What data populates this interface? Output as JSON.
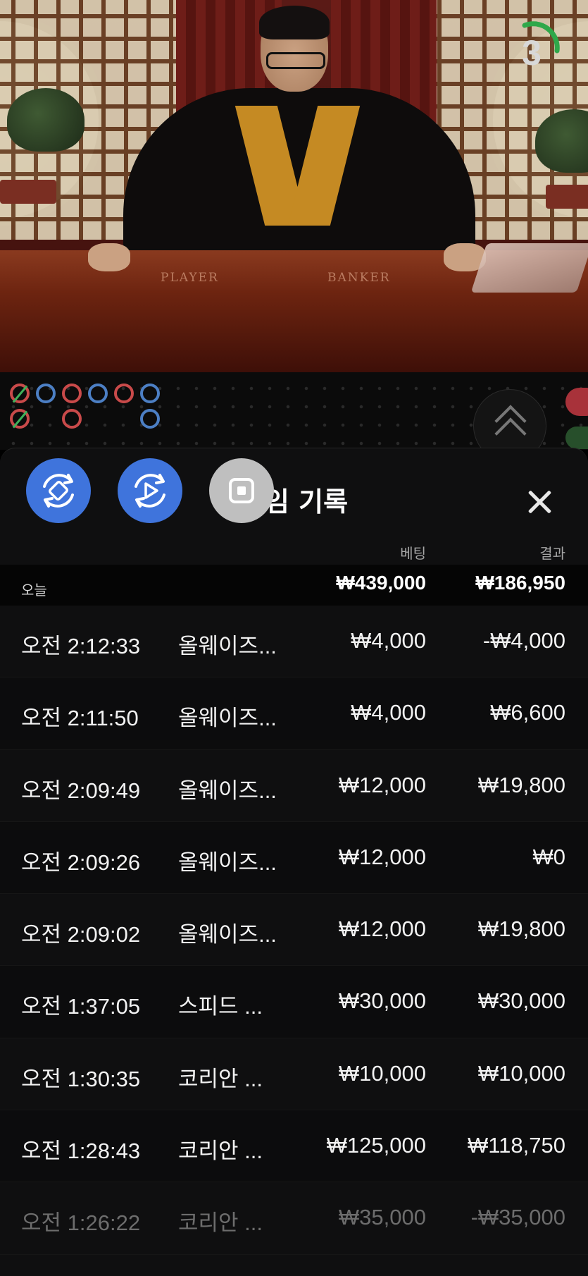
{
  "video": {
    "countdown": "3",
    "table_labels": {
      "player": "PLAYER",
      "banker": "BANKER"
    }
  },
  "history": {
    "title": "게임 기록",
    "columns": {
      "bet": "베팅",
      "result": "결과"
    },
    "today": {
      "label": "오늘",
      "bet": "₩439,000",
      "result": "₩186,950"
    },
    "rows": [
      {
        "time": "오전 2:12:33",
        "game": "올웨이즈...",
        "bet": "₩4,000",
        "result": "-₩4,000"
      },
      {
        "time": "오전 2:11:50",
        "game": "올웨이즈...",
        "bet": "₩4,000",
        "result": "₩6,600"
      },
      {
        "time": "오전 2:09:49",
        "game": "올웨이즈...",
        "bet": "₩12,000",
        "result": "₩19,800"
      },
      {
        "time": "오전 2:09:26",
        "game": "올웨이즈...",
        "bet": "₩12,000",
        "result": "₩0"
      },
      {
        "time": "오전 2:09:02",
        "game": "올웨이즈...",
        "bet": "₩12,000",
        "result": "₩19,800"
      },
      {
        "time": "오전 1:37:05",
        "game": "스피드 ...",
        "bet": "₩30,000",
        "result": "₩30,000"
      },
      {
        "time": "오전 1:30:35",
        "game": "코리안 ...",
        "bet": "₩10,000",
        "result": "₩10,000"
      },
      {
        "time": "오전 1:28:43",
        "game": "코리안 ...",
        "bet": "₩125,000",
        "result": "₩118,750"
      },
      {
        "time": "오전 1:26:22",
        "game": "코리안 ...",
        "bet": "₩35,000",
        "result": "-₩35,000"
      }
    ]
  },
  "icons": {
    "fab_1": "rotate-sync-icon",
    "fab_2": "replay-video-icon",
    "fab_3": "stop-square-icon",
    "close": "close-icon",
    "expand": "chevron-up-double-icon"
  },
  "colors": {
    "accent_blue": "#3f74dc",
    "fab_gray": "#bfbfbf",
    "road_red": "#c94a4a",
    "road_blue": "#4c7fc4",
    "timer_green": "#2fa84a",
    "sheet_bg": "#0f0f10"
  }
}
